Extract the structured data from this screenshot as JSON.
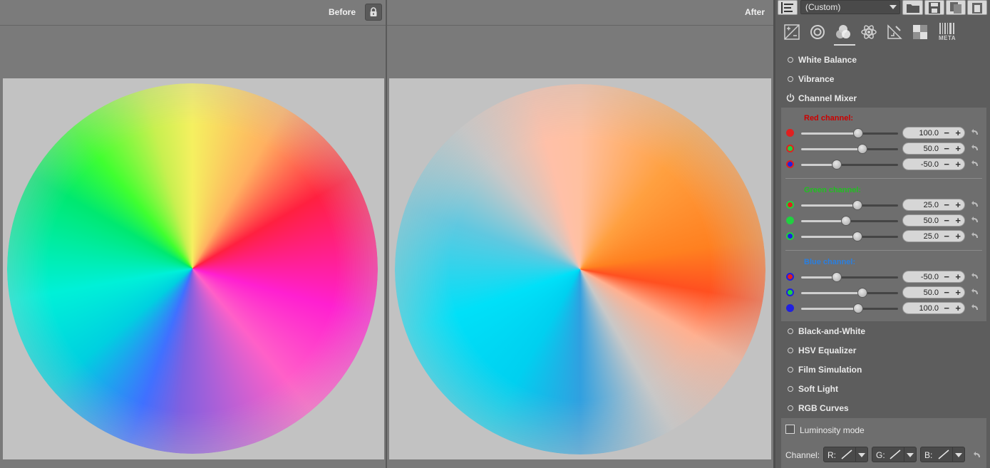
{
  "preview": {
    "before_label": "Before",
    "after_label": "After"
  },
  "toolbar": {
    "profile_value": "(Custom)"
  },
  "tabs": [
    "exposure-tab",
    "detail-tab",
    "color-tab",
    "advanced-tab",
    "transform-tab",
    "raw-tab",
    "metadata-tab"
  ],
  "metadata_tab_label": "META",
  "sections_top": [
    {
      "title": "White Balance"
    },
    {
      "title": "Vibrance"
    },
    {
      "title": "Channel Mixer"
    }
  ],
  "channel_mixer": {
    "red": {
      "title": "Red channel:",
      "color": "#cc0000",
      "rows": [
        {
          "value": "100.0",
          "fraction": 0.59,
          "swatch": "red"
        },
        {
          "value": "50.0",
          "fraction": 0.63,
          "swatch": "green"
        },
        {
          "value": "-50.0",
          "fraction": 0.37,
          "swatch": "blue"
        }
      ]
    },
    "green": {
      "title": "Green channel:",
      "color": "#20c020",
      "rows": [
        {
          "value": "25.0",
          "fraction": 0.58,
          "swatch": "red"
        },
        {
          "value": "50.0",
          "fraction": 0.46,
          "swatch": "green"
        },
        {
          "value": "25.0",
          "fraction": 0.58,
          "swatch": "blue"
        }
      ]
    },
    "blue": {
      "title": "Blue channel:",
      "color": "#2a7fe0",
      "rows": [
        {
          "value": "-50.0",
          "fraction": 0.37,
          "swatch": "red"
        },
        {
          "value": "50.0",
          "fraction": 0.63,
          "swatch": "green"
        },
        {
          "value": "100.0",
          "fraction": 0.59,
          "swatch": "blue"
        }
      ]
    }
  },
  "sections_bottom": [
    {
      "title": "Black-and-White"
    },
    {
      "title": "HSV Equalizer"
    },
    {
      "title": "Film Simulation"
    },
    {
      "title": "Soft Light"
    },
    {
      "title": "RGB Curves"
    }
  ],
  "rgb_curves": {
    "luminosity_label": "Luminosity mode",
    "channel_label": "Channel:",
    "r_label": "R:",
    "g_label": "G:",
    "b_label": "B:"
  }
}
